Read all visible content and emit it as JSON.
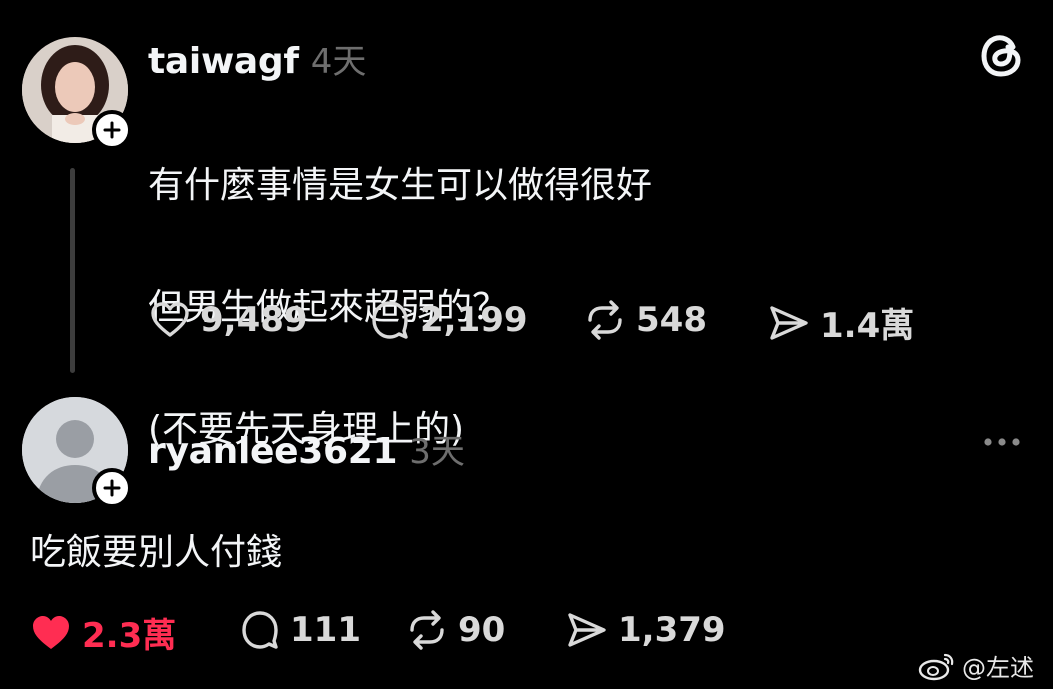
{
  "post": {
    "username": "taiwagf",
    "time": "4天",
    "lines": [
      "有什麼事情是女生可以做得很好",
      "但男生做起來超弱的？",
      "(不要先天身理上的)"
    ],
    "likes": "9,489",
    "comments": "2,199",
    "reposts": "548",
    "shares": "1.4萬"
  },
  "reply": {
    "username": "ryanlee3621",
    "time": "3天",
    "text": "吃飯要別人付錢",
    "likes": "2.3萬",
    "liked": true,
    "comments": "111",
    "reposts": "90",
    "shares": "1,379"
  },
  "watermark": {
    "text": "@左述"
  },
  "colors": {
    "background": "#000000",
    "liked": "#ff2d52",
    "muted": "#6e6e6e"
  }
}
